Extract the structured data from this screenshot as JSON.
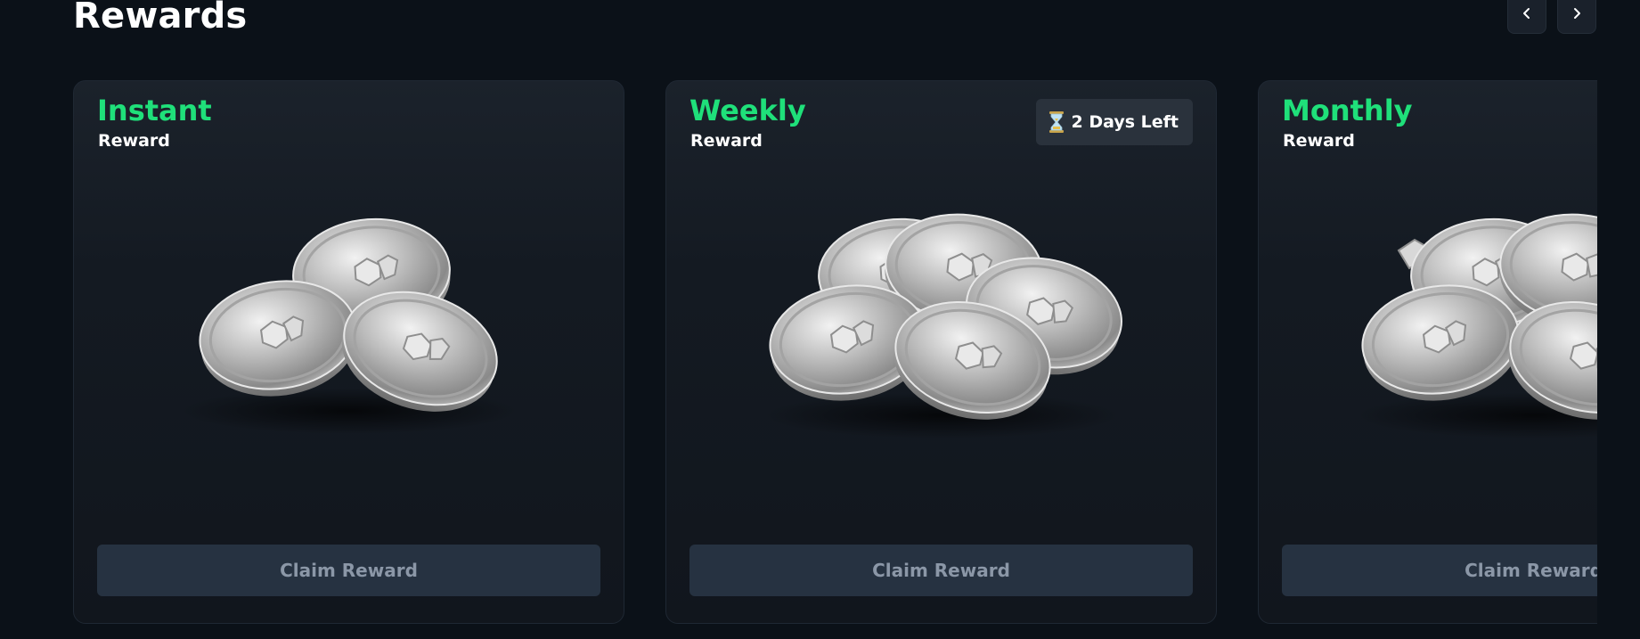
{
  "section": {
    "title": "Rewards"
  },
  "nav": {
    "prev_icon": "chevron-left-icon",
    "next_icon": "chevron-right-icon"
  },
  "colors": {
    "background": "#0b1118",
    "accent_green": "#1fe07a",
    "card": "#141a22",
    "button": "#263241",
    "button_text": "#8b97a7"
  },
  "cards": [
    {
      "type": "Instant",
      "subtitle": "Reward",
      "badge": null,
      "image": "silver-coins-icon",
      "button_label": "Claim Reward"
    },
    {
      "type": "Weekly",
      "subtitle": "Reward",
      "badge": {
        "icon": "hourglass-icon",
        "text": "2 Days Left"
      },
      "image": "silver-coins-icon",
      "button_label": "Claim Reward"
    },
    {
      "type": "Monthly",
      "subtitle": "Reward",
      "badge": null,
      "image": "silver-coins-icon",
      "button_label": "Claim Reward"
    }
  ]
}
